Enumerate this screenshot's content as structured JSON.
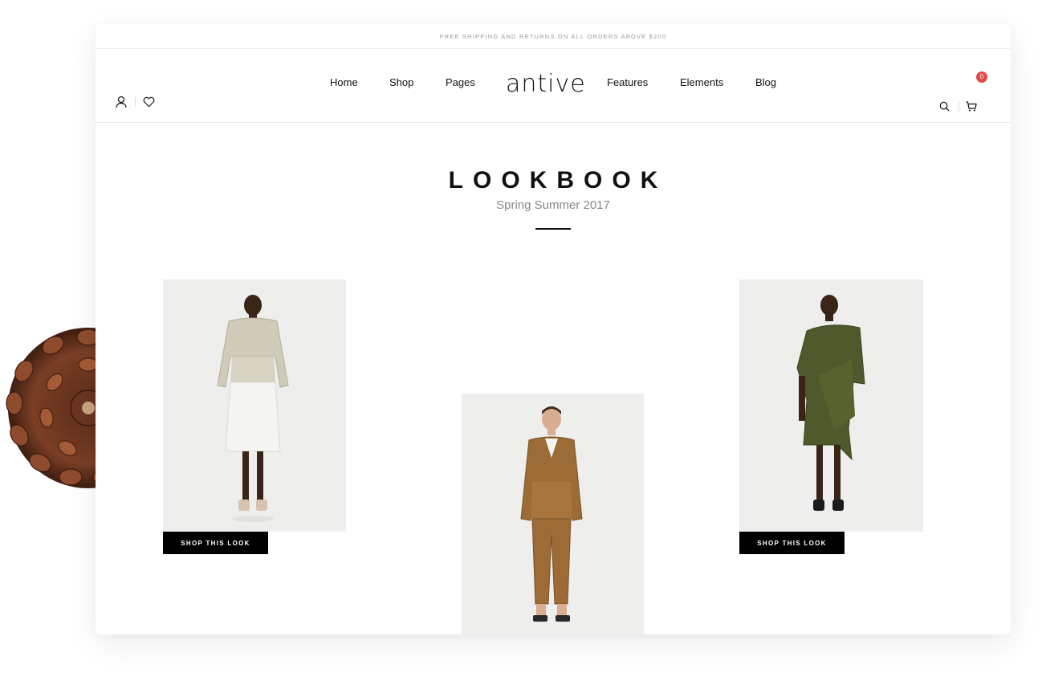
{
  "topbar": {
    "text": "FREE SHIPPING AND RETURNS ON ALL ORDERS ABOVE $200"
  },
  "header": {
    "logo": "antive",
    "nav_left": [
      "Home",
      "Shop",
      "Pages"
    ],
    "nav_right": [
      "Features",
      "Elements",
      "Blog"
    ],
    "icons": [
      "user-icon",
      "heart-icon",
      "search-icon",
      "cart-icon"
    ],
    "cart_count": "0"
  },
  "hero": {
    "title": "LOOKBOOK",
    "subtitle": "Spring Summer 2017"
  },
  "looks": [
    {
      "image": "model-silver-jacket-white-skirt",
      "button": "SHOP THIS LOOK"
    },
    {
      "image": "model-brown-suit"
    },
    {
      "image": "model-olive-drape-dress",
      "button": "SHOP THIS LOOK"
    }
  ],
  "decor": {
    "image": "pinecone"
  },
  "colors": {
    "accent": "#000000",
    "badge": "#e04a4a",
    "muted": "#888888"
  }
}
